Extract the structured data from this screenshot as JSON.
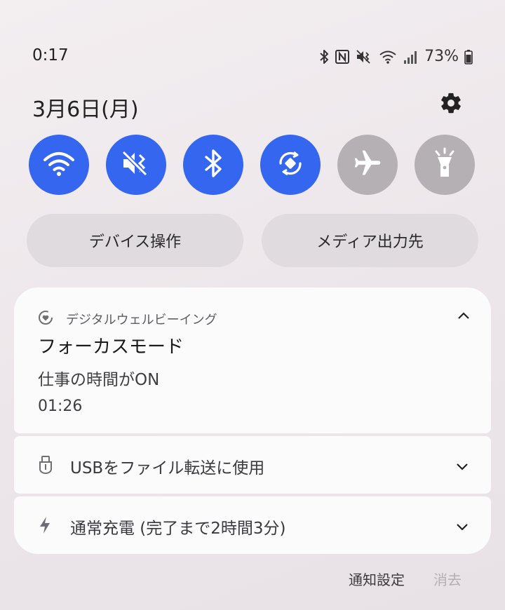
{
  "status_bar": {
    "time": "0:17",
    "battery": "73%",
    "icons": [
      "bluetooth-icon",
      "nfc-icon",
      "vibrate-icon",
      "wifi-icon",
      "signal-icon",
      "battery-icon"
    ]
  },
  "header": {
    "date": "3月6日(月)",
    "settings_icon": "gear-icon"
  },
  "quick_settings": [
    {
      "name": "Wi-Fi",
      "icon": "wifi-icon",
      "active": true
    },
    {
      "name": "Vibrate",
      "icon": "vibrate-icon",
      "active": true
    },
    {
      "name": "Bluetooth",
      "icon": "bluetooth-icon",
      "active": true
    },
    {
      "name": "Auto rotate",
      "icon": "rotate-icon",
      "active": true
    },
    {
      "name": "Airplane mode",
      "icon": "airplane-icon",
      "active": false
    },
    {
      "name": "Flashlight",
      "icon": "flashlight-icon",
      "active": false
    }
  ],
  "pills": {
    "device_control": "デバイス操作",
    "media_output": "メディア出力先"
  },
  "notification": {
    "app_name": "デジタルウェルビーイング",
    "title": "フォーカスモード",
    "text": "仕事の時間がON",
    "time": "01:26"
  },
  "system_rows": {
    "usb_label": "USBをファイル転送に使用",
    "charging_label": "通常充電 (完了まで2時間3分)"
  },
  "footer": {
    "notification_settings": "通知設定",
    "clear": "消去"
  },
  "colors": {
    "active": "#3566f0",
    "inactive": "#b4b0b3"
  }
}
